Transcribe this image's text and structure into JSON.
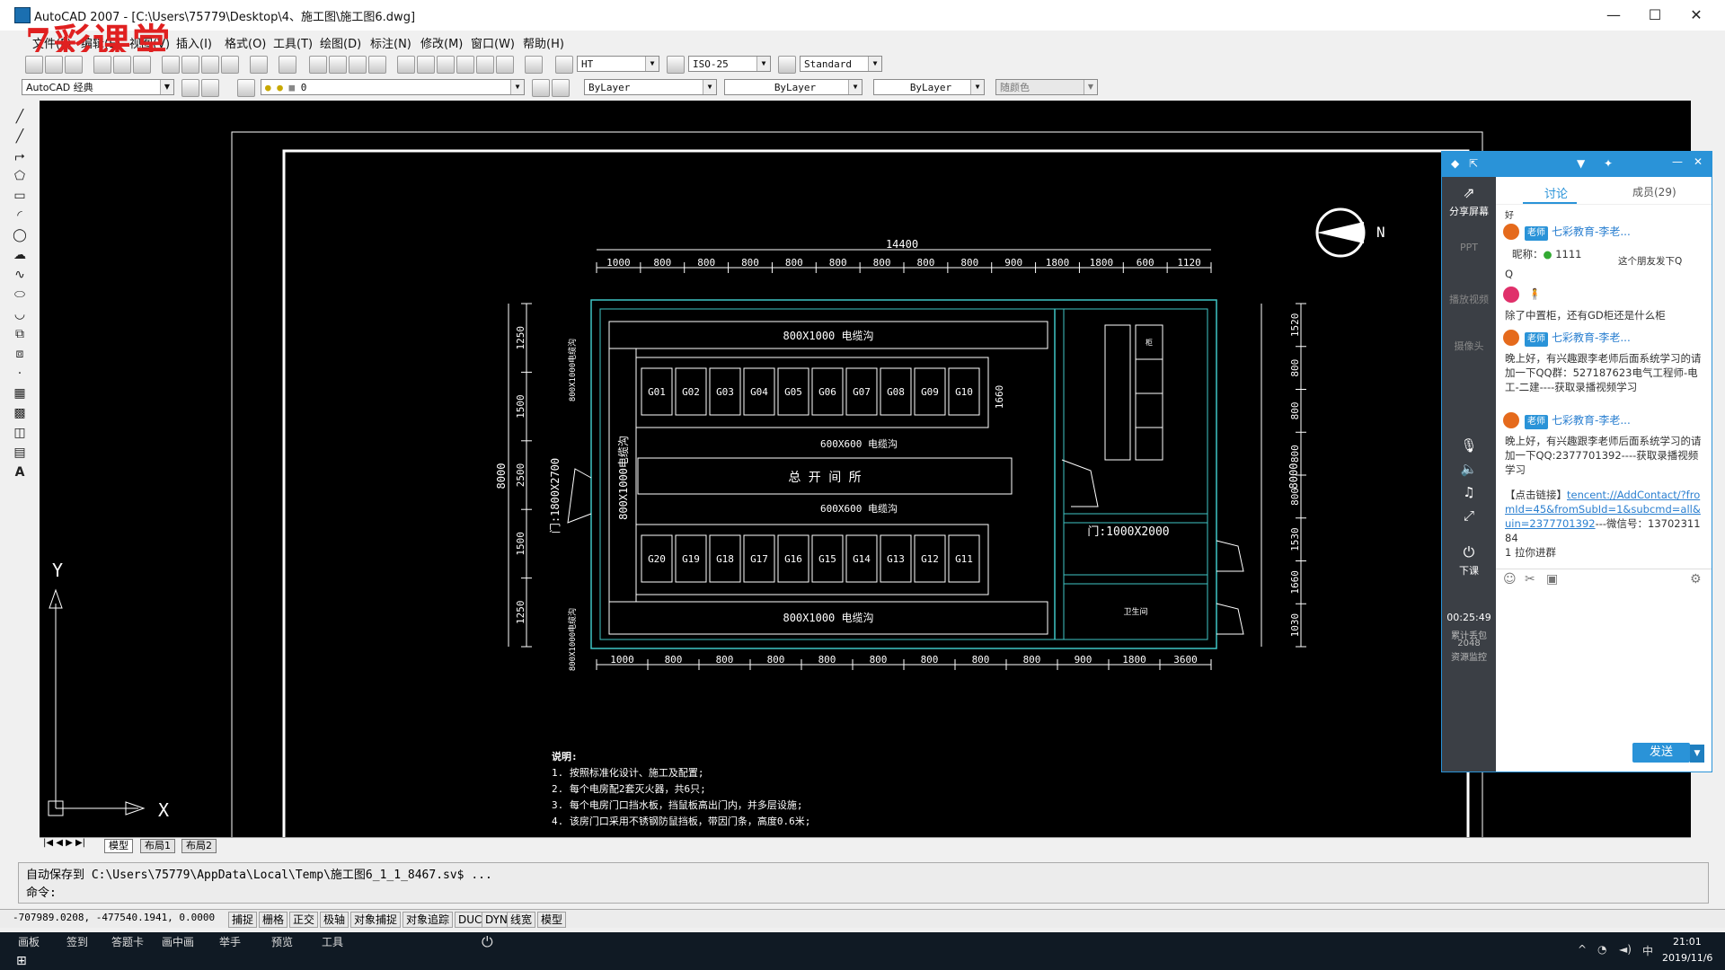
{
  "window": {
    "title": "AutoCAD 2007 - [C:\\Users\\75779\\Desktop\\4、施工图\\施工图6.dwg]",
    "watermark": "7彩课堂",
    "minimize": "—",
    "maximize": "☐",
    "close": "✕"
  },
  "menu": [
    "文件(F)",
    "编辑(E)",
    "视图(V)",
    "插入(I)",
    "格式(O)",
    "工具(T)",
    "绘图(D)",
    "标注(N)",
    "修改(M)",
    "窗口(W)",
    "帮助(H)"
  ],
  "toolbar": {
    "text_style": "HT",
    "dim_style": "ISO-25",
    "table_style": "Standard",
    "workspace": "AutoCAD 经典",
    "layer": "0",
    "color": "ByLayer",
    "linetype": "ByLayer",
    "lineweight": "ByLayer",
    "plotstyle": "随颜色"
  },
  "drawing": {
    "total_width": "14400",
    "top_dims": [
      "1000",
      "800",
      "800",
      "800",
      "800",
      "800",
      "800",
      "800",
      "800",
      "900",
      "1800",
      "1800",
      "600",
      "1120"
    ],
    "bottom_dims": [
      "1000",
      "800",
      "800",
      "800",
      "800",
      "800",
      "800",
      "800",
      "800",
      "900",
      "1800",
      "3600"
    ],
    "left_dims": [
      "1250",
      "1500",
      "2500",
      "1500",
      "1250"
    ],
    "left_total": "8000",
    "right_dims": [
      "1520",
      "800",
      "800",
      "800",
      "800",
      "1530",
      "1660",
      "1030"
    ],
    "right_total": "8000",
    "top_row": [
      "G01",
      "G02",
      "G03",
      "G04",
      "G05",
      "G06",
      "G07",
      "G08",
      "G09",
      "G10"
    ],
    "bottom_row": [
      "G20",
      "G19",
      "G18",
      "G17",
      "G16",
      "G15",
      "G14",
      "G13",
      "G12",
      "G11"
    ],
    "top_trench": "800X1000 电缆沟",
    "mid_trench_1": "600X600 电缆沟",
    "mid_trench_2": "600X600 电缆沟",
    "bottom_trench": "800X1000 电缆沟",
    "left_trench": "800X1000电缆沟",
    "corridor": "总 开 间 所",
    "door_left": "门:1800X2700",
    "door_right": "门:1000X2000",
    "row_dim": "1660",
    "left_vert_label_top": "800X1000电缆沟",
    "left_vert_label_bottom": "800X1000电缆沟",
    "room_label": "卫生间",
    "cabinet_label": "柜",
    "north": "N",
    "axis_x": "X",
    "axis_y": "Y",
    "notes_title": "说明:",
    "notes": [
      "1. 按照标准化设计、施工及配置;",
      "2. 每个电房配2套灭火器，共6只;",
      "3. 每个电房门口挡水板，挡鼠板高出门内，并多层设施;",
      "4. 该房门口采用不锈钢防鼠挡板，带因门条，高度0.6米;"
    ]
  },
  "layout_tabs": [
    "模型",
    "布局1",
    "布局2"
  ],
  "command": {
    "autosave": "自动保存到 C:\\Users\\75779\\AppData\\Local\\Temp\\施工图6_1_1_8467.sv$ ...",
    "prompt": "命令:"
  },
  "status": {
    "coords": "-707989.0208, -477540.1941, 0.0000",
    "buttons": [
      "捕捉",
      "栅格",
      "正交",
      "极轴",
      "对象捕捉",
      "对象追踪",
      "DUCS",
      "DYN",
      "线宽",
      "模型"
    ]
  },
  "classroom_bar": [
    "画板",
    "签到",
    "答题卡",
    "画中画",
    "举手",
    "预览",
    "工具"
  ],
  "taskbar": {
    "time": "21:01",
    "date": "2019/11/6",
    "ime": "中"
  },
  "chat": {
    "tab_discuss": "讨论",
    "tab_members": "成员(29)",
    "side": [
      "分享屏幕",
      "PPT",
      "播放视频",
      "摄像头",
      "下课"
    ],
    "timer": "00:25:49",
    "timer_sub": "累计丢包",
    "timer_value": "2048",
    "timer_sub2": "资源监控",
    "teacher_badge": "老师",
    "teacher_name": "七彩教育-李老...",
    "msg_snippet_top": "好",
    "nickname_label": "昵称：",
    "nickname_value": "1111",
    "reply_hint": "这个朋友发下Q",
    "q": "Q",
    "question": "除了中置柜，还有GD柜还是什么柜",
    "msg1": "晚上好，有兴趣跟李老师后面系统学习的请加一下QQ群：527187623电气工程师-电工-二建----获取录播视频学习",
    "msg2": "晚上好，有兴趣跟李老师后面系统学习的请加一下QQ:2377701392----获取录播视频学习",
    "link_prefix": "【点击链接】",
    "link": "tencent://AddContact/?fromId=45&fromSubId=1&subcmd=all&uin=2377701392",
    "link_suffix": "---微信号：1370231184",
    "join": "1 拉你进群",
    "send": "发送"
  }
}
